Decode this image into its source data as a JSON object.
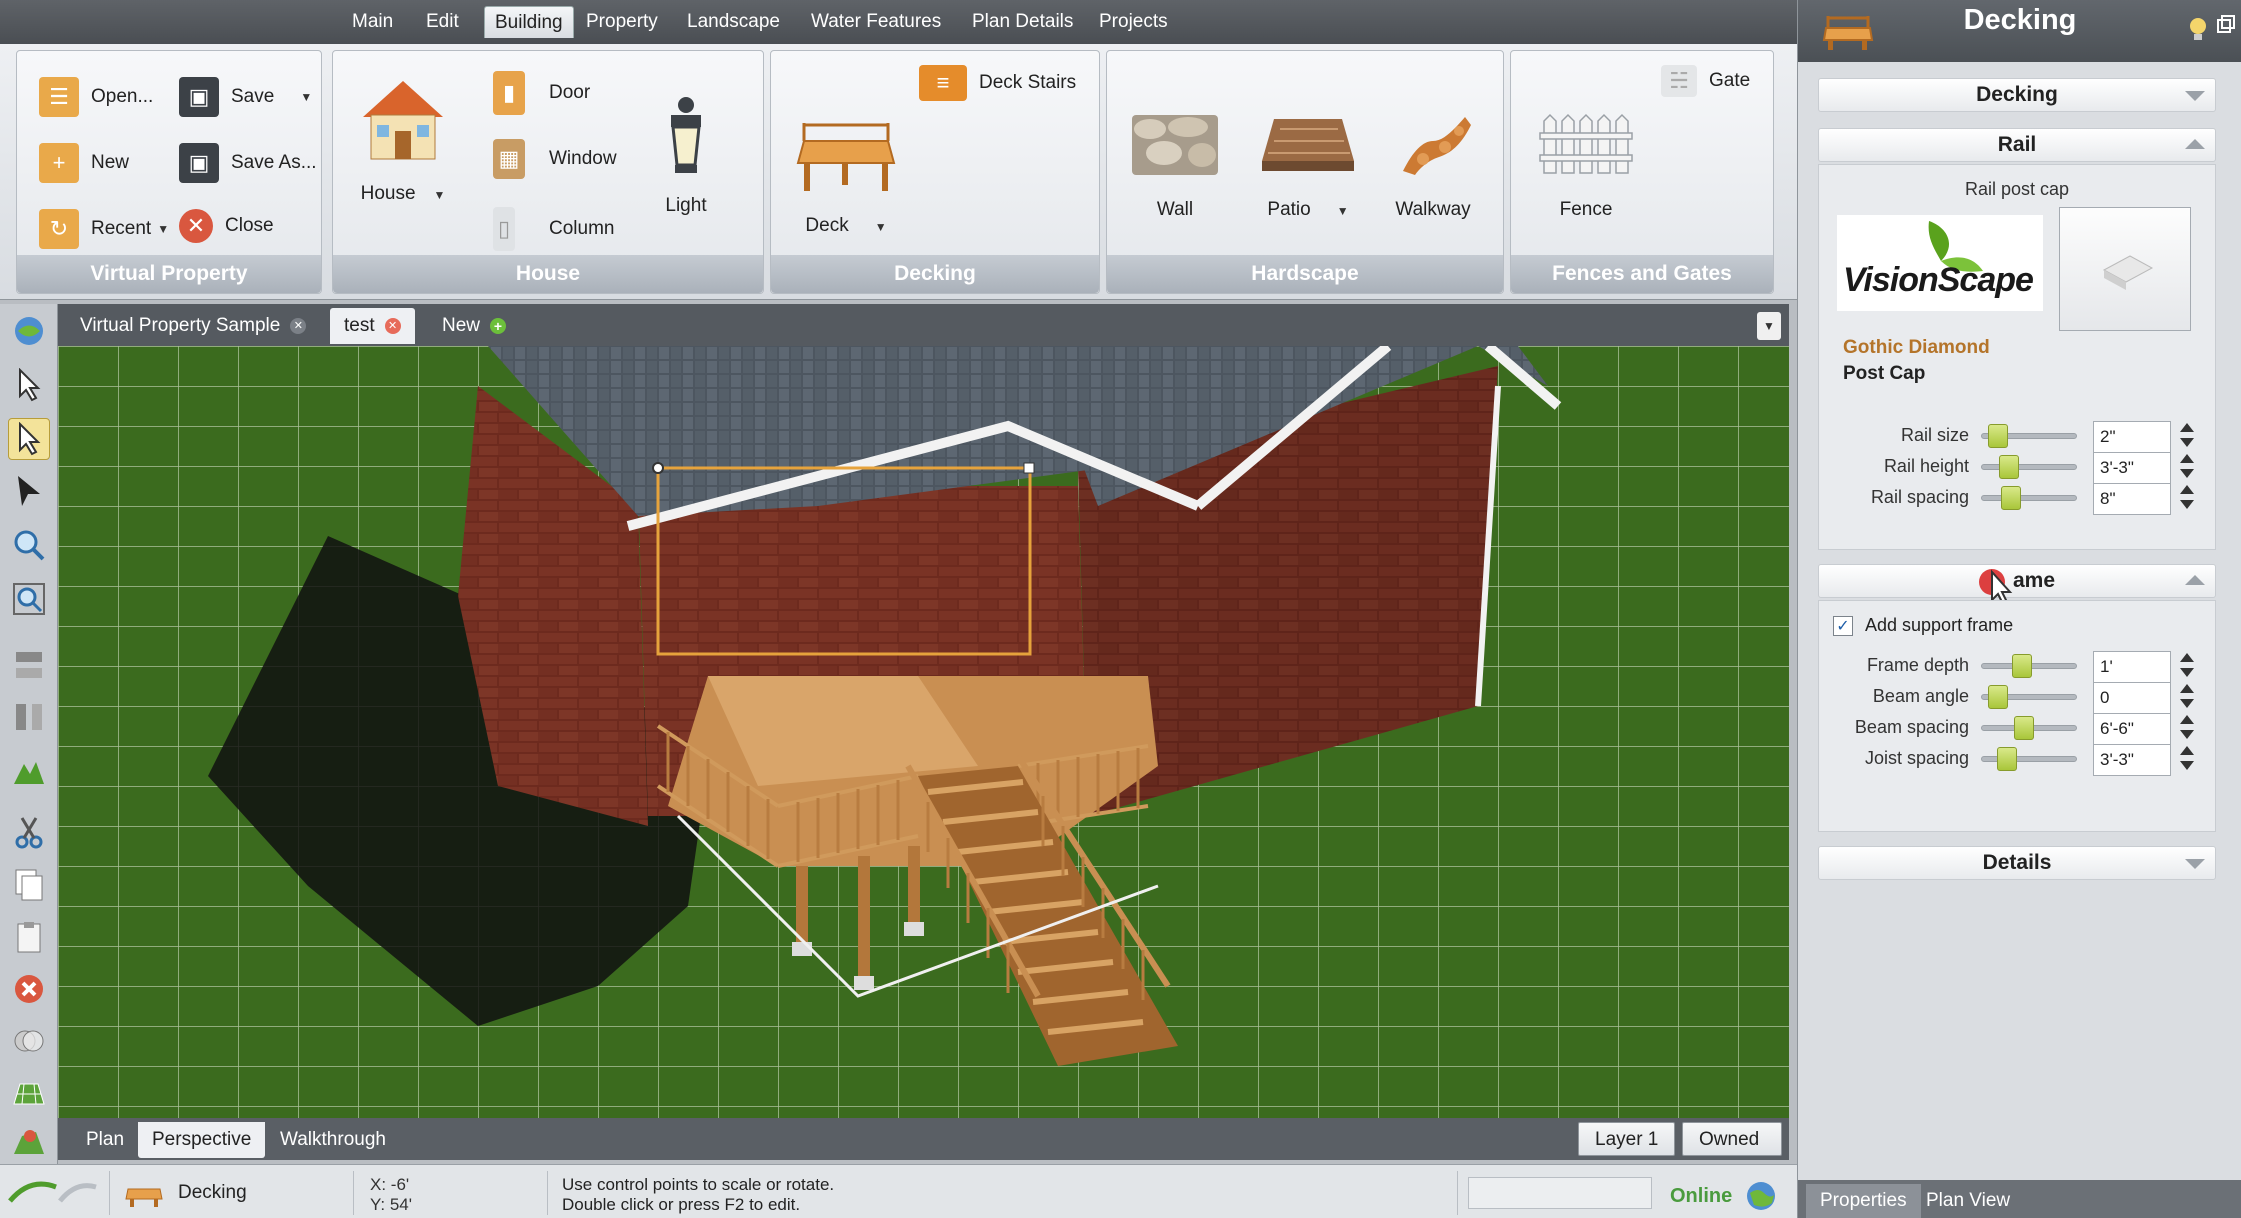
{
  "menu": {
    "items": [
      {
        "label": "Main"
      },
      {
        "label": "Edit"
      },
      {
        "label": "Building"
      },
      {
        "label": "Property"
      },
      {
        "label": "Landscape"
      },
      {
        "label": "Water Features"
      },
      {
        "label": "Plan Details"
      },
      {
        "label": "Projects"
      }
    ],
    "active": "Building"
  },
  "ribbon": {
    "virtual_property": {
      "label": "Virtual Property",
      "open": "Open...",
      "save": "Save",
      "new": "New",
      "save_as": "Save As...",
      "recent": "Recent",
      "close": "Close"
    },
    "house": {
      "label": "House",
      "house": "House",
      "door": "Door",
      "window": "Window",
      "column": "Column",
      "light": "Light"
    },
    "decking": {
      "label": "Decking",
      "deck": "Deck",
      "deck_stairs": "Deck Stairs"
    },
    "hardscape": {
      "label": "Hardscape",
      "wall": "Wall",
      "patio": "Patio",
      "walkway": "Walkway"
    },
    "fences": {
      "label": "Fences and Gates",
      "fence": "Fence",
      "gate": "Gate"
    }
  },
  "doc_tabs": [
    {
      "label": "Virtual Property Sample"
    },
    {
      "label": "test"
    },
    {
      "label": "New"
    }
  ],
  "view_tabs": {
    "plan": "Plan",
    "perspective": "Perspective",
    "walkthrough": "Walkthrough",
    "layer": "Layer 1",
    "owned": "Owned"
  },
  "status": {
    "object": "Decking",
    "x": "X:  -6'",
    "y": "Y:  54'",
    "hint_line1": "Use control points to scale or rotate.",
    "hint_line2": "Double click or press F2 to edit.",
    "online": "Online"
  },
  "panel": {
    "title": "Decking",
    "section_decking": "Decking",
    "section_rail": "Rail",
    "rail_post_cap_label": "Rail post cap",
    "brand": "VisionScape",
    "cap_name_line1": "Gothic Diamond",
    "cap_name_line2": "Post Cap",
    "rail_rows": [
      {
        "label": "Rail size",
        "value": "2\"",
        "level": 0.1
      },
      {
        "label": "Rail height",
        "value": "3'-3\"",
        "level": 0.22
      },
      {
        "label": "Rail spacing",
        "value": "8\"",
        "level": 0.24
      }
    ],
    "section_frame": "Frame",
    "frame_visible": "ame",
    "add_support_frame": "Add support frame",
    "add_support_checked": true,
    "frame_rows": [
      {
        "label": "Frame depth",
        "value": "1'",
        "level": 0.35
      },
      {
        "label": "Beam angle",
        "value": "0",
        "level": 0.1
      },
      {
        "label": "Beam spacing",
        "value": "6'-6\"",
        "level": 0.38
      },
      {
        "label": "Joist spacing",
        "value": "3'-3\"",
        "level": 0.2
      }
    ],
    "section_details": "Details",
    "bottom_tabs": {
      "properties": "Properties",
      "plan_view": "Plan View"
    }
  },
  "colors": {
    "accent_orange": "#b4742a",
    "selection": "#f3e39a",
    "grass": "#3c6a1f",
    "brand_green": "#5aa21d"
  },
  "icons": [
    "folder-icon",
    "save-icon",
    "new-icon",
    "save-as-icon",
    "recent-icon",
    "close-icon",
    "house-icon",
    "door-icon",
    "window-icon",
    "column-icon",
    "light-icon",
    "deck-icon",
    "deck-stairs-icon",
    "wall-icon",
    "patio-icon",
    "walkway-icon",
    "fence-icon",
    "gate-icon"
  ]
}
